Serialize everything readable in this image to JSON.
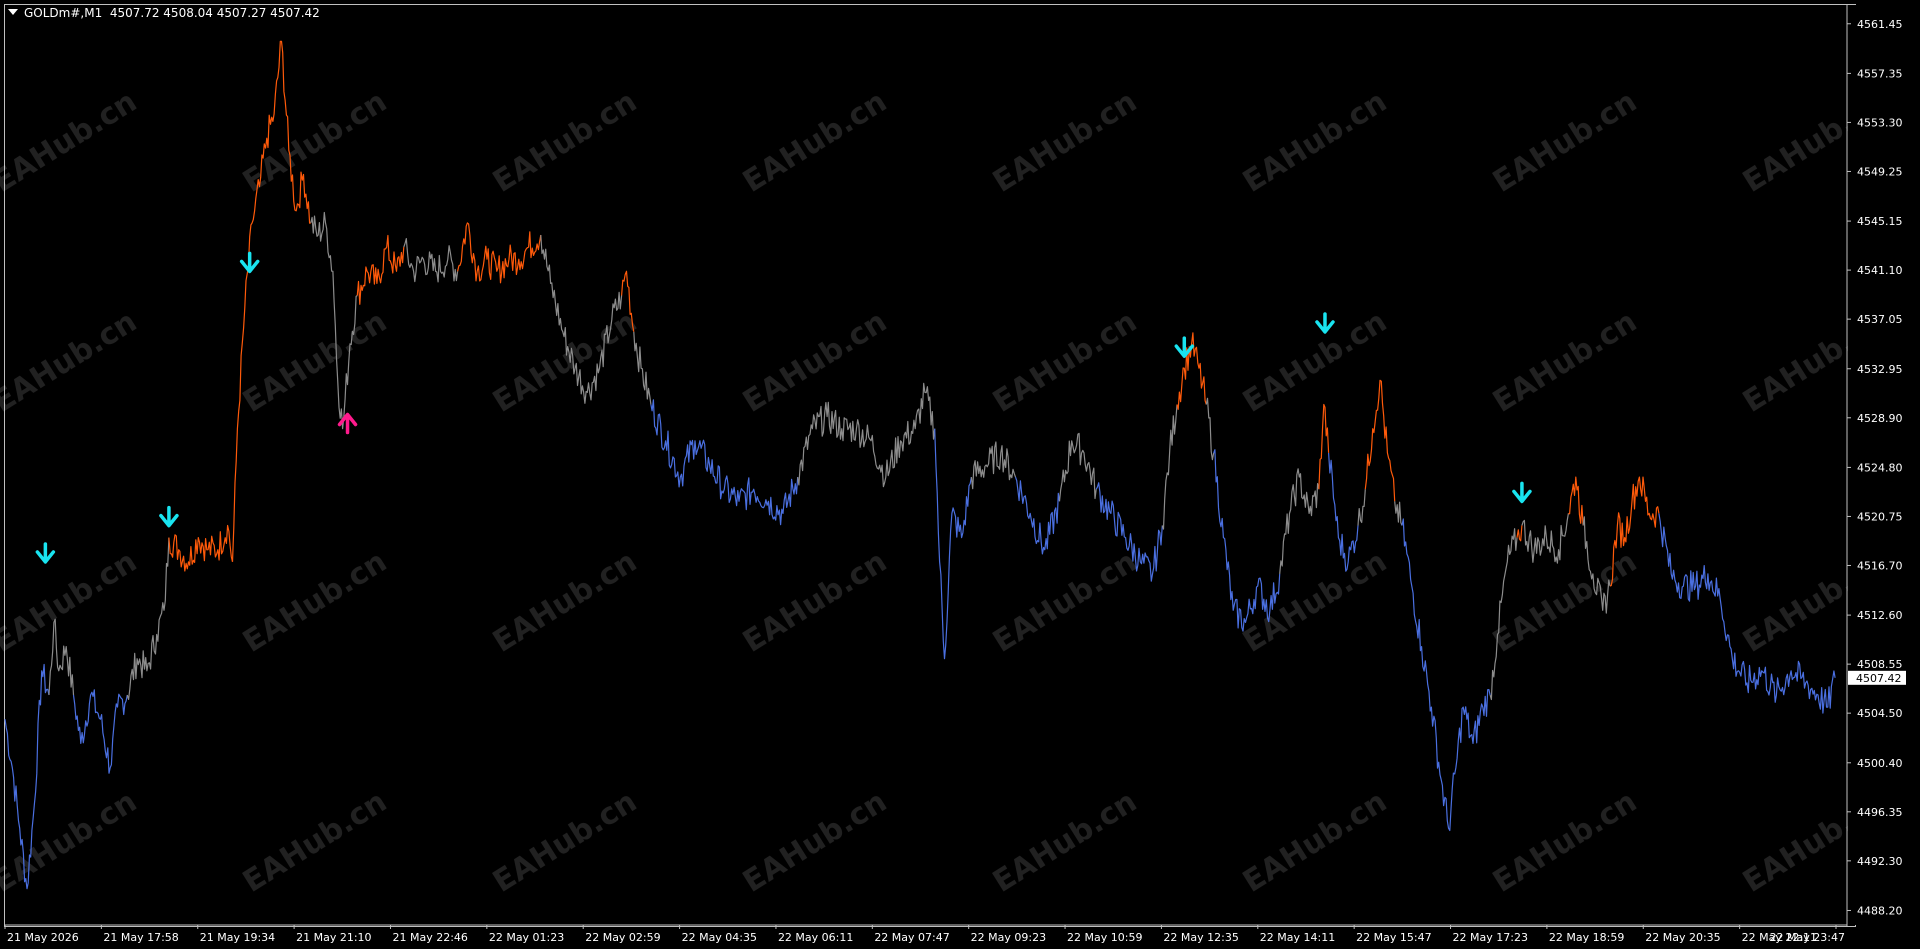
{
  "header": {
    "symbol": "GOLDm#,M1",
    "ohlc": "4507.72 4508.04 4507.27 4507.42"
  },
  "colors": {
    "background": "#000000",
    "axis": "#c0c0c0",
    "neutral": "#8c8c8c",
    "bullish": "#ff5a0a",
    "bearish": "#4a6fe0",
    "sell_arrow": "#19e4f0",
    "buy_arrow": "#ff1a8c",
    "watermark": "#ffffff"
  },
  "watermark_text": "EAHub.cn",
  "chart_data": {
    "type": "line",
    "title": "",
    "xlabel": "",
    "ylabel": "",
    "grid": false,
    "ylim": [
      4487.0,
      4563.0
    ],
    "y_ticks": [
      "4561.45",
      "4557.35",
      "4553.30",
      "4549.25",
      "4545.15",
      "4541.10",
      "4537.05",
      "4532.95",
      "4528.90",
      "4524.80",
      "4520.75",
      "4516.70",
      "4512.60",
      "4508.55",
      "4504.50",
      "4500.40",
      "4496.35",
      "4492.30",
      "4488.20"
    ],
    "current_price": "4507.42",
    "x_ticks": [
      "21 May 2026",
      "21 May 17:58",
      "21 May 19:34",
      "21 May 21:10",
      "21 May 22:46",
      "22 May 01:23",
      "22 May 02:59",
      "22 May 04:35",
      "22 May 06:11",
      "22 May 07:47",
      "22 May 09:23",
      "22 May 10:59",
      "22 May 12:35",
      "22 May 14:11",
      "22 May 15:47",
      "22 May 17:23",
      "22 May 18:59",
      "22 May 20:35",
      "22 May 22:11",
      "22 May 23:47"
    ],
    "x_range": [
      0,
      1500
    ],
    "series": [
      {
        "color_key": "bearish",
        "points": [
          [
            0,
            4504
          ],
          [
            6,
            4500
          ],
          [
            12,
            4495
          ],
          [
            18,
            4490
          ],
          [
            24,
            4497
          ],
          [
            30,
            4508
          ],
          [
            36,
            4506
          ]
        ]
      },
      {
        "color_key": "neutral",
        "points": [
          [
            36,
            4506
          ],
          [
            40,
            4512
          ],
          [
            44,
            4508
          ],
          [
            50,
            4510
          ],
          [
            56,
            4506
          ]
        ]
      },
      {
        "color_key": "bearish",
        "points": [
          [
            56,
            4506
          ],
          [
            62,
            4502
          ],
          [
            70,
            4506
          ],
          [
            78,
            4504
          ],
          [
            86,
            4500
          ],
          [
            92,
            4505
          ],
          [
            100,
            4506
          ]
        ]
      },
      {
        "color_key": "neutral",
        "points": [
          [
            100,
            4506
          ],
          [
            108,
            4509
          ],
          [
            116,
            4508
          ],
          [
            124,
            4511
          ],
          [
            130,
            4513
          ],
          [
            134,
            4519
          ]
        ]
      },
      {
        "color_key": "bullish",
        "points": [
          [
            134,
            4519
          ],
          [
            142,
            4518
          ],
          [
            150,
            4517
          ],
          [
            158,
            4519
          ],
          [
            166,
            4518
          ],
          [
            174,
            4518
          ],
          [
            182,
            4520
          ],
          [
            186,
            4517
          ]
        ]
      },
      {
        "color_key": "bullish",
        "points": [
          [
            186,
            4517
          ],
          [
            190,
            4528
          ],
          [
            196,
            4538
          ],
          [
            202,
            4545
          ],
          [
            208,
            4548
          ],
          [
            214,
            4552
          ],
          [
            220,
            4554
          ],
          [
            226,
            4560
          ],
          [
            232,
            4551
          ],
          [
            238,
            4546
          ],
          [
            244,
            4549
          ],
          [
            250,
            4545
          ]
        ]
      },
      {
        "color_key": "neutral",
        "points": [
          [
            250,
            4545
          ],
          [
            256,
            4544
          ],
          [
            262,
            4545
          ],
          [
            268,
            4541
          ],
          [
            272,
            4532
          ],
          [
            276,
            4528
          ],
          [
            282,
            4535
          ],
          [
            288,
            4539
          ]
        ]
      },
      {
        "color_key": "bullish",
        "points": [
          [
            288,
            4539
          ],
          [
            296,
            4541
          ],
          [
            304,
            4540
          ],
          [
            312,
            4543
          ],
          [
            320,
            4541
          ],
          [
            326,
            4543
          ]
        ]
      },
      {
        "color_key": "neutral",
        "points": [
          [
            326,
            4543
          ],
          [
            334,
            4541
          ],
          [
            342,
            4542
          ],
          [
            352,
            4541
          ],
          [
            362,
            4542
          ],
          [
            370,
            4541
          ]
        ]
      },
      {
        "color_key": "bullish",
        "points": [
          [
            370,
            4541
          ],
          [
            378,
            4545
          ],
          [
            386,
            4541
          ],
          [
            394,
            4542
          ],
          [
            402,
            4541
          ],
          [
            412,
            4542
          ],
          [
            420,
            4542
          ],
          [
            428,
            4543
          ],
          [
            438,
            4544
          ]
        ]
      },
      {
        "color_key": "neutral",
        "points": [
          [
            438,
            4544
          ],
          [
            446,
            4540
          ],
          [
            456,
            4536
          ],
          [
            466,
            4533
          ],
          [
            476,
            4531
          ],
          [
            486,
            4533
          ],
          [
            496,
            4537
          ],
          [
            504,
            4539
          ]
        ]
      },
      {
        "color_key": "bullish",
        "points": [
          [
            504,
            4539
          ],
          [
            508,
            4541
          ],
          [
            514,
            4536
          ]
        ]
      },
      {
        "color_key": "neutral",
        "points": [
          [
            514,
            4536
          ],
          [
            520,
            4533
          ],
          [
            528,
            4530
          ]
        ]
      },
      {
        "color_key": "bearish",
        "points": [
          [
            528,
            4530
          ],
          [
            540,
            4527
          ],
          [
            552,
            4524
          ],
          [
            564,
            4527
          ],
          [
            576,
            4525
          ],
          [
            588,
            4523
          ],
          [
            600,
            4522
          ],
          [
            612,
            4523
          ],
          [
            624,
            4522
          ],
          [
            636,
            4521
          ],
          [
            648,
            4524
          ]
        ]
      },
      {
        "color_key": "neutral",
        "points": [
          [
            648,
            4524
          ],
          [
            660,
            4528
          ],
          [
            672,
            4529
          ],
          [
            684,
            4528
          ],
          [
            696,
            4528
          ],
          [
            708,
            4527
          ],
          [
            720,
            4524
          ],
          [
            732,
            4527
          ],
          [
            744,
            4528
          ],
          [
            752,
            4531
          ],
          [
            760,
            4528
          ]
        ]
      },
      {
        "color_key": "bearish",
        "points": [
          [
            760,
            4528
          ],
          [
            764,
            4517
          ],
          [
            768,
            4509
          ],
          [
            774,
            4521
          ],
          [
            782,
            4519
          ],
          [
            790,
            4524
          ]
        ]
      },
      {
        "color_key": "neutral",
        "points": [
          [
            790,
            4524
          ],
          [
            802,
            4525
          ],
          [
            814,
            4526
          ],
          [
            826,
            4524
          ]
        ]
      },
      {
        "color_key": "bearish",
        "points": [
          [
            826,
            4524
          ],
          [
            838,
            4521
          ],
          [
            850,
            4518
          ],
          [
            862,
            4522
          ]
        ]
      },
      {
        "color_key": "neutral",
        "points": [
          [
            862,
            4522
          ],
          [
            872,
            4527
          ],
          [
            882,
            4526
          ],
          [
            892,
            4523
          ]
        ]
      },
      {
        "color_key": "bearish",
        "points": [
          [
            892,
            4523
          ],
          [
            904,
            4521
          ],
          [
            916,
            4519
          ],
          [
            928,
            4517
          ],
          [
            938,
            4516
          ],
          [
            946,
            4520
          ]
        ]
      },
      {
        "color_key": "neutral",
        "points": [
          [
            946,
            4520
          ],
          [
            952,
            4526
          ],
          [
            958,
            4530
          ]
        ]
      },
      {
        "color_key": "bullish",
        "points": [
          [
            958,
            4530
          ],
          [
            964,
            4533
          ],
          [
            970,
            4535
          ],
          [
            976,
            4533
          ],
          [
            982,
            4530
          ]
        ]
      },
      {
        "color_key": "neutral",
        "points": [
          [
            982,
            4530
          ],
          [
            988,
            4526
          ]
        ]
      },
      {
        "color_key": "bearish",
        "points": [
          [
            988,
            4526
          ],
          [
            996,
            4519
          ],
          [
            1004,
            4513
          ],
          [
            1014,
            4512
          ],
          [
            1024,
            4515
          ],
          [
            1034,
            4513
          ],
          [
            1042,
            4516
          ]
        ]
      },
      {
        "color_key": "neutral",
        "points": [
          [
            1042,
            4516
          ],
          [
            1050,
            4521
          ],
          [
            1058,
            4524
          ],
          [
            1066,
            4521
          ],
          [
            1074,
            4523
          ]
        ]
      },
      {
        "color_key": "bullish",
        "points": [
          [
            1074,
            4523
          ],
          [
            1078,
            4530
          ],
          [
            1082,
            4526
          ]
        ]
      },
      {
        "color_key": "bearish",
        "points": [
          [
            1082,
            4526
          ],
          [
            1090,
            4519
          ],
          [
            1098,
            4517
          ],
          [
            1106,
            4520
          ]
        ]
      },
      {
        "color_key": "neutral",
        "points": [
          [
            1106,
            4520
          ],
          [
            1112,
            4523
          ]
        ]
      },
      {
        "color_key": "bullish",
        "points": [
          [
            1112,
            4523
          ],
          [
            1118,
            4528
          ],
          [
            1124,
            4532
          ],
          [
            1130,
            4526
          ],
          [
            1136,
            4522
          ]
        ]
      },
      {
        "color_key": "neutral",
        "points": [
          [
            1136,
            4522
          ],
          [
            1142,
            4520
          ]
        ]
      },
      {
        "color_key": "bearish",
        "points": [
          [
            1142,
            4520
          ],
          [
            1150,
            4515
          ],
          [
            1158,
            4510
          ],
          [
            1166,
            4505
          ],
          [
            1174,
            4499
          ],
          [
            1180,
            4495
          ],
          [
            1186,
            4500
          ],
          [
            1192,
            4505
          ],
          [
            1200,
            4502
          ],
          [
            1208,
            4505
          ],
          [
            1214,
            4506
          ]
        ]
      },
      {
        "color_key": "neutral",
        "points": [
          [
            1214,
            4506
          ],
          [
            1220,
            4511
          ],
          [
            1228,
            4517
          ],
          [
            1236,
            4519
          ]
        ]
      },
      {
        "color_key": "bullish",
        "points": [
          [
            1236,
            4519
          ],
          [
            1240,
            4520
          ]
        ]
      },
      {
        "color_key": "neutral",
        "points": [
          [
            1240,
            4520
          ],
          [
            1250,
            4518
          ],
          [
            1260,
            4519
          ],
          [
            1270,
            4518
          ],
          [
            1278,
            4521
          ]
        ]
      },
      {
        "color_key": "bullish",
        "points": [
          [
            1278,
            4521
          ],
          [
            1284,
            4524
          ],
          [
            1290,
            4520
          ]
        ]
      },
      {
        "color_key": "neutral",
        "points": [
          [
            1290,
            4520
          ],
          [
            1298,
            4516
          ],
          [
            1306,
            4513
          ],
          [
            1312,
            4515
          ]
        ]
      },
      {
        "color_key": "bullish",
        "points": [
          [
            1312,
            4515
          ],
          [
            1318,
            4520
          ],
          [
            1324,
            4519
          ],
          [
            1330,
            4522
          ],
          [
            1336,
            4524
          ],
          [
            1344,
            4521
          ],
          [
            1352,
            4521
          ]
        ]
      },
      {
        "color_key": "bearish",
        "points": [
          [
            1352,
            4521
          ],
          [
            1362,
            4516
          ],
          [
            1372,
            4515
          ],
          [
            1382,
            4515
          ],
          [
            1392,
            4516
          ],
          [
            1402,
            4514
          ],
          [
            1412,
            4509
          ],
          [
            1424,
            4507
          ],
          [
            1436,
            4508
          ],
          [
            1448,
            4506
          ],
          [
            1460,
            4508
          ],
          [
            1472,
            4507
          ],
          [
            1482,
            4506
          ],
          [
            1490,
            4505
          ],
          [
            1496,
            4507.42
          ]
        ]
      }
    ],
    "signals": [
      {
        "type": "sell",
        "x": 33,
        "y": 4516
      },
      {
        "type": "sell",
        "x": 134,
        "y": 4519
      },
      {
        "type": "sell",
        "x": 200,
        "y": 4540
      },
      {
        "type": "buy",
        "x": 280,
        "y": 4530
      },
      {
        "type": "sell",
        "x": 964,
        "y": 4533
      },
      {
        "type": "sell",
        "x": 1079,
        "y": 4535
      },
      {
        "type": "sell",
        "x": 1240,
        "y": 4521
      }
    ]
  }
}
